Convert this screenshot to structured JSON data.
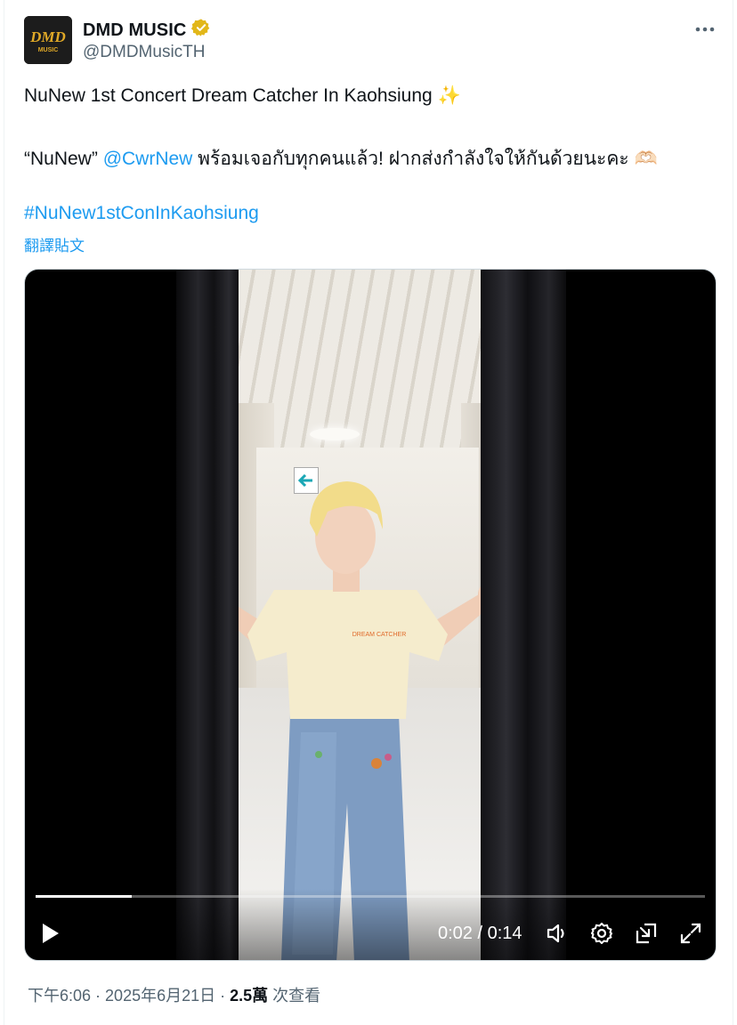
{
  "author": {
    "display_name": "DMD MUSIC",
    "handle": "@DMDMusicTH",
    "avatar_logo_text": "DMD",
    "avatar_logo_sub": "MUSIC",
    "verified_icon": "gold-verified-badge-icon"
  },
  "menu": {
    "icon": "more-horizontal-icon"
  },
  "tweet": {
    "line1_text": "NuNew 1st Concert Dream Catcher In Kaohsiung ",
    "line1_emoji": "✨",
    "line2_prefix": "“NuNew” ",
    "line2_mention": "@CwrNew",
    "line2_suffix": " พร้อมเจอกับทุกคนแล้ว! ฝากส่งกำลังใจให้กันด้วยนะคะ ",
    "line2_emoji": "🫶🏻",
    "hashtag": "#NuNew1stConInKaohsiung",
    "translate_label": "翻譯貼文"
  },
  "video": {
    "current_time": "0:02",
    "separator": " / ",
    "duration": "0:14",
    "progress_fraction": 0.143,
    "shirt_print": "DREAM CATCHER",
    "icons": [
      "play-icon",
      "volume-icon",
      "settings-gear-icon",
      "dock-icon",
      "fullscreen-icon"
    ]
  },
  "footer": {
    "time": "下午6:06",
    "dot": " · ",
    "date": "2025年6月21日",
    "dot2": " · ",
    "views": "2.5萬",
    "views_label": " 次查看"
  },
  "colors": {
    "link": "#1d9bf0",
    "secondary_text": "#536471",
    "primary_text": "#0f1419",
    "verified_gold": "#e2b719"
  }
}
